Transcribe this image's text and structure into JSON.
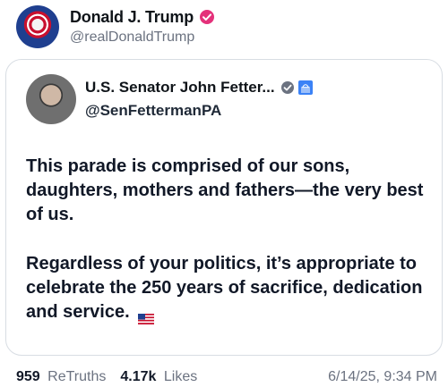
{
  "post": {
    "author_name": "Donald J. Trump",
    "author_handle": "@realDonaldTrump"
  },
  "quote": {
    "author_name": "U.S. Senator John Fetter...",
    "author_handle": "@SenFettermanPA",
    "paragraphs": [
      "This parade is comprised of our sons, daughters, mothers and fathers—the very best of us.",
      "Regardless of your politics, it’s appropriate to celebrate the 250 years of sacrifice, dedication and service."
    ]
  },
  "footer": {
    "retruths_count": "959",
    "retruths_label": "ReTruths",
    "likes_count": "4.17k",
    "likes_label": "Likes",
    "timestamp": "6/14/25, 9:34 PM"
  },
  "colors": {
    "verified_pink": "#e4317a",
    "verified_gray": "#6b7280",
    "border": "#d8dde3"
  },
  "icons": [
    "verified-badge-icon",
    "capitol-icon",
    "us-flag-icon"
  ]
}
